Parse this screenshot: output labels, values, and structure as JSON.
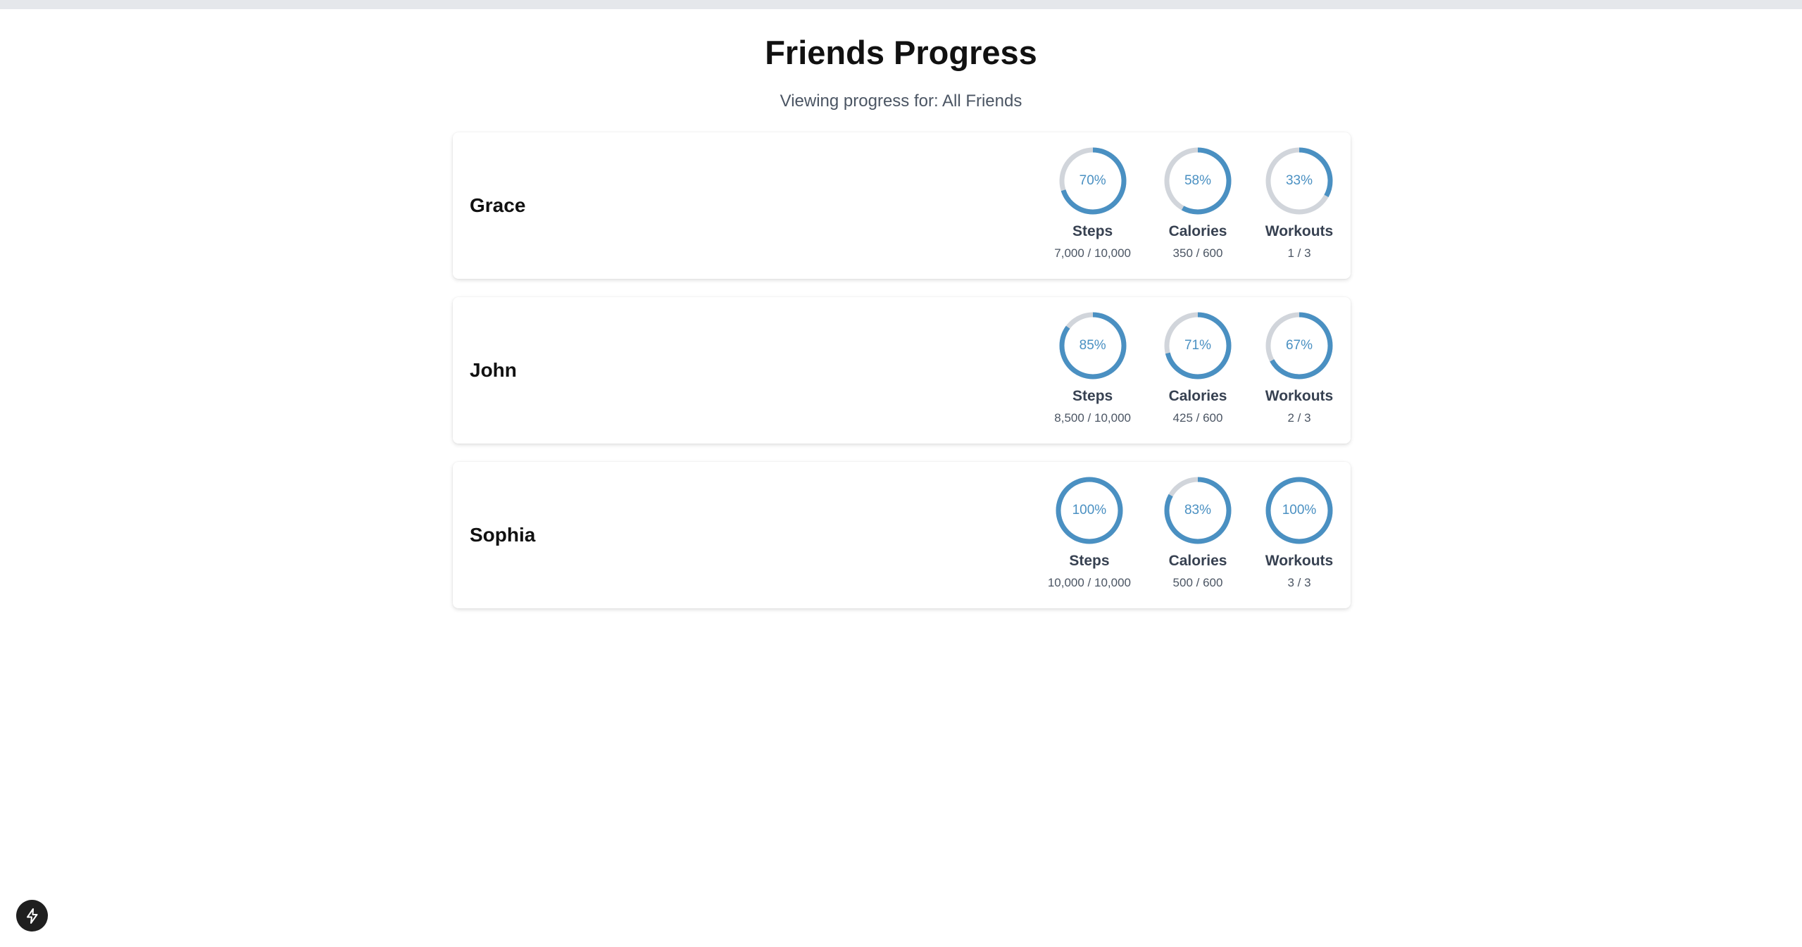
{
  "header": {
    "title": "Friends Progress",
    "subtitle": "Viewing progress for: All Friends"
  },
  "colors": {
    "accent": "#4a90c2",
    "track": "#d1d5db",
    "top_bar": "#e5e7eb"
  },
  "friends": [
    {
      "name": "Grace",
      "metrics": [
        {
          "label": "Steps",
          "percent": 70,
          "percent_text": "70%",
          "value": "7,000 / 10,000"
        },
        {
          "label": "Calories",
          "percent": 58,
          "percent_text": "58%",
          "value": "350 / 600"
        },
        {
          "label": "Workouts",
          "percent": 33,
          "percent_text": "33%",
          "value": "1 / 3"
        }
      ]
    },
    {
      "name": "John",
      "metrics": [
        {
          "label": "Steps",
          "percent": 85,
          "percent_text": "85%",
          "value": "8,500 / 10,000"
        },
        {
          "label": "Calories",
          "percent": 71,
          "percent_text": "71%",
          "value": "425 / 600"
        },
        {
          "label": "Workouts",
          "percent": 67,
          "percent_text": "67%",
          "value": "2 / 3"
        }
      ]
    },
    {
      "name": "Sophia",
      "metrics": [
        {
          "label": "Steps",
          "percent": 100,
          "percent_text": "100%",
          "value": "10,000 / 10,000"
        },
        {
          "label": "Calories",
          "percent": 83,
          "percent_text": "83%",
          "value": "500 / 600"
        },
        {
          "label": "Workouts",
          "percent": 100,
          "percent_text": "100%",
          "value": "3 / 3"
        }
      ]
    }
  ],
  "corner_button": {
    "icon": "lightning-bolt-icon"
  }
}
